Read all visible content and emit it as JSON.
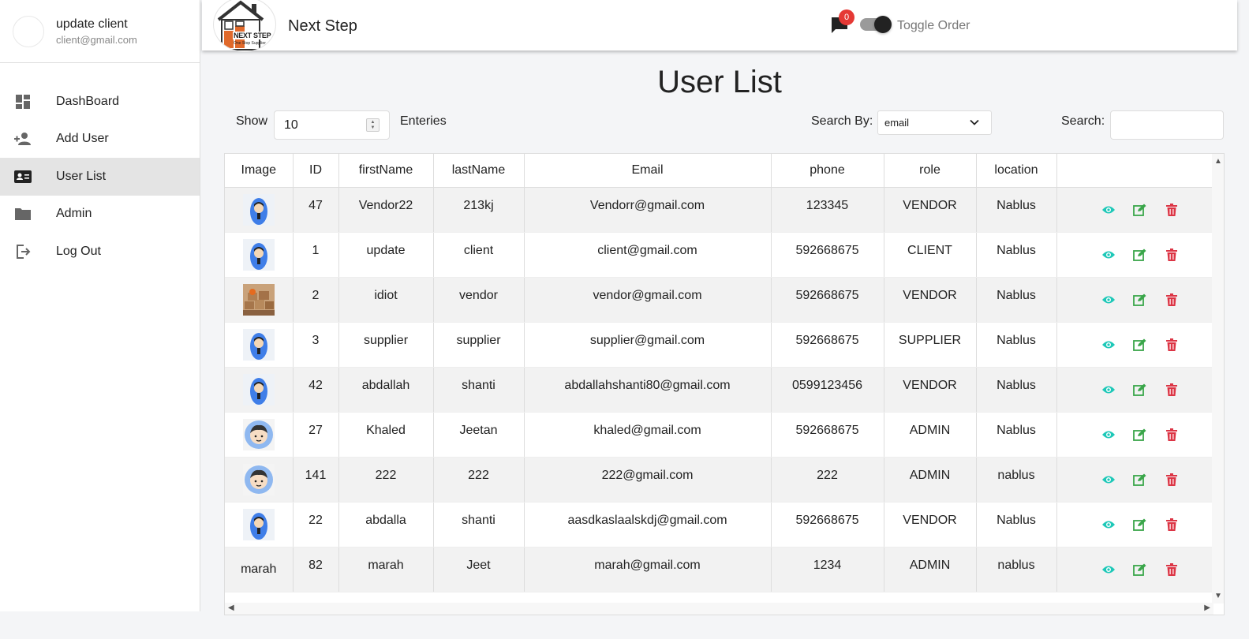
{
  "profile": {
    "name": "update client",
    "email": "client@gmail.com"
  },
  "nav": [
    {
      "label": "DashBoard",
      "icon": "dashboard-icon"
    },
    {
      "label": "Add User",
      "icon": "add-user-icon"
    },
    {
      "label": "User List",
      "icon": "contact-card-icon",
      "active": true
    },
    {
      "label": "Admin",
      "icon": "folder-icon"
    },
    {
      "label": "Log Out",
      "icon": "logout-icon"
    }
  ],
  "header": {
    "brand": "Next Step",
    "logo_text": "NEXT STEP",
    "logo_subtext": "One Stop Supplier",
    "notification_count": "0",
    "toggle_label": "Toggle Order"
  },
  "page": {
    "title": "User List"
  },
  "controls": {
    "show_label": "Show",
    "entries_value": "10",
    "entries_label": "Enteries",
    "search_by_label": "Search By:",
    "search_by_value": "email",
    "search_label": "Search:"
  },
  "table": {
    "columns": [
      "Image",
      "ID",
      "firstName",
      "lastName",
      "Email",
      "phone",
      "role",
      "location"
    ],
    "rows": [
      {
        "image": "avatar-blue",
        "id": "47",
        "firstName": "Vendor22",
        "lastName": "213kj",
        "email": "Vendorr@gmail.com",
        "phone": "123345",
        "role": "VENDOR",
        "location": "Nablus"
      },
      {
        "image": "avatar-blue",
        "id": "1",
        "firstName": "update",
        "lastName": "client",
        "email": "client@gmail.com",
        "phone": "592668675",
        "role": "CLIENT",
        "location": "Nablus"
      },
      {
        "image": "boxes-photo",
        "id": "2",
        "firstName": "idiot",
        "lastName": "vendor",
        "email": "vendor@gmail.com",
        "phone": "592668675",
        "role": "VENDOR",
        "location": "Nablus"
      },
      {
        "image": "avatar-blue",
        "id": "3",
        "firstName": "supplier",
        "lastName": "supplier",
        "email": "supplier@gmail.com",
        "phone": "592668675",
        "role": "SUPPLIER",
        "location": "Nablus"
      },
      {
        "image": "avatar-blue",
        "id": "42",
        "firstName": "abdallah",
        "lastName": "shanti",
        "email": "abdallahshanti80@gmail.com",
        "phone": "0599123456",
        "role": "VENDOR",
        "location": "Nablus"
      },
      {
        "image": "avatar-boy",
        "id": "27",
        "firstName": "Khaled",
        "lastName": "Jeetan",
        "email": "khaled@gmail.com",
        "phone": "592668675",
        "role": "ADMIN",
        "location": "Nablus"
      },
      {
        "image": "avatar-boy",
        "id": "141",
        "firstName": "222",
        "lastName": "222",
        "email": "222@gmail.com",
        "phone": "222",
        "role": "ADMIN",
        "location": "nablus"
      },
      {
        "image": "avatar-blue",
        "id": "22",
        "firstName": "abdalla",
        "lastName": "shanti",
        "email": "aasdkaslaalskdj@gmail.com",
        "phone": "592668675",
        "role": "VENDOR",
        "location": "Nablus"
      },
      {
        "image": "text",
        "image_alt": "marah",
        "id": "82",
        "firstName": "marah",
        "lastName": "Jeet",
        "email": "marah@gmail.com",
        "phone": "1234",
        "role": "ADMIN",
        "location": "nablus"
      }
    ],
    "actions": [
      "view-icon",
      "edit-icon",
      "delete-icon"
    ]
  },
  "colors": {
    "view": "#1ec8b8",
    "edit": "#3aa64a",
    "delete": "#dc3545",
    "badge": "#e53935",
    "active_nav": "#e4e4e4"
  }
}
